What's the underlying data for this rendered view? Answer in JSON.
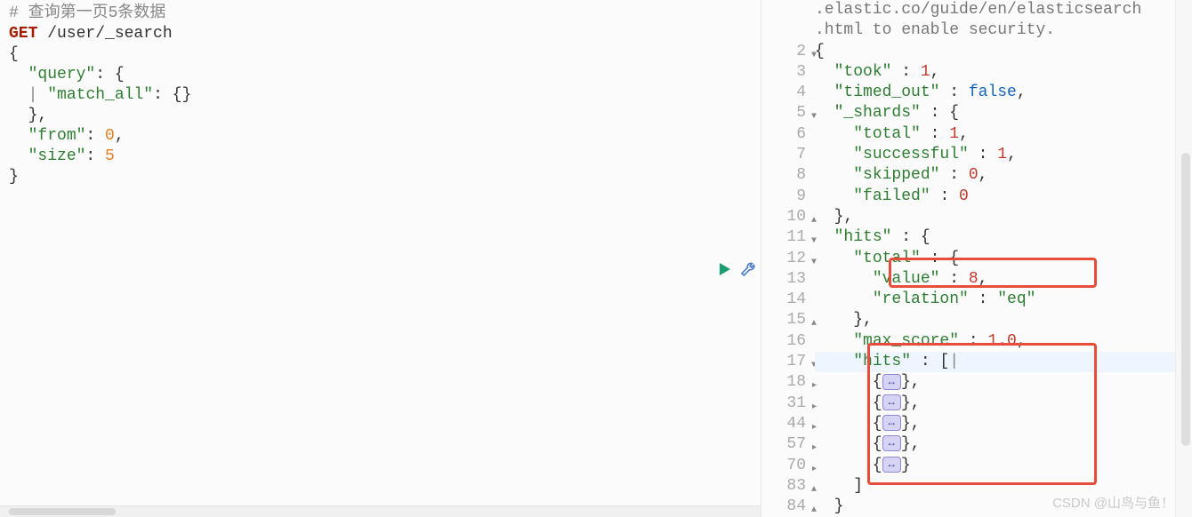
{
  "left": {
    "comment_prefix": "# ",
    "comment": "查询第一页5条数据",
    "method": "GET",
    "path": " /user/_search",
    "line3": "{",
    "query_key": "\"query\"",
    "match_all_key": "\"match_all\"",
    "line5_end": ": {}",
    "from_key": "\"from\"",
    "from_val": "0",
    "size_key": "\"size\"",
    "size_val": "5",
    "line9": "}"
  },
  "right_top": {
    "l1": ".elastic.co/guide/en/elasticsearch",
    "l2": ".html to enable security."
  },
  "lines": [
    {
      "n": "2",
      "fold": "▼",
      "c": "{"
    },
    {
      "n": "3",
      "fold": "",
      "c_key": "\"took\"",
      "c_after": " : ",
      "c_val": "1",
      "c_end": ","
    },
    {
      "n": "4",
      "fold": "",
      "c_key": "\"timed_out\"",
      "c_after": " : ",
      "c_bool": "false",
      "c_end": ","
    },
    {
      "n": "5",
      "fold": "▼",
      "c_key": "\"_shards\"",
      "c_after": " : {"
    },
    {
      "n": "6",
      "fold": "",
      "c_key": "\"total\"",
      "c_after": " : ",
      "c_val": "1",
      "c_end": ","
    },
    {
      "n": "7",
      "fold": "",
      "c_key": "\"successful\"",
      "c_after": " : ",
      "c_val": "1",
      "c_end": ","
    },
    {
      "n": "8",
      "fold": "",
      "c_key": "\"skipped\"",
      "c_after": " : ",
      "c_val": "0",
      "c_end": ","
    },
    {
      "n": "9",
      "fold": "",
      "c_key": "\"failed\"",
      "c_after": " : ",
      "c_val": "0"
    },
    {
      "n": "10",
      "fold": "▲",
      "c": "},",
      "ind": 1
    },
    {
      "n": "11",
      "fold": "▼",
      "c_key": "\"hits\"",
      "c_after": " : {"
    },
    {
      "n": "12",
      "fold": "▼",
      "c_key": "\"total\"",
      "c_after": " : {"
    },
    {
      "n": "13",
      "fold": "",
      "c_key": "\"value\"",
      "c_after": " : ",
      "c_val": "8",
      "c_end": ","
    },
    {
      "n": "14",
      "fold": "",
      "c_key": "\"relation\"",
      "c_after": " : ",
      "c_str": "\"eq\""
    },
    {
      "n": "15",
      "fold": "▲",
      "c": "},",
      "ind": 2
    },
    {
      "n": "16",
      "fold": "",
      "c_key": "\"max_score\"",
      "c_after": " : ",
      "c_val": "1.0",
      "c_end": ","
    },
    {
      "n": "17",
      "fold": "▼",
      "c_key": "\"hits\"",
      "c_after": " : [",
      "hl": true,
      "caret": "|"
    },
    {
      "n": "18",
      "fold": "▸",
      "badge": true,
      "bend": ","
    },
    {
      "n": "31",
      "fold": "▸",
      "badge": true,
      "bend": ","
    },
    {
      "n": "44",
      "fold": "▸",
      "badge": true,
      "bend": ","
    },
    {
      "n": "57",
      "fold": "▸",
      "badge": true,
      "bend": ","
    },
    {
      "n": "70",
      "fold": "▸",
      "badge": true,
      "bend": ""
    },
    {
      "n": "83",
      "fold": "▲",
      "c": "]",
      "ind": 2
    },
    {
      "n": "84",
      "fold": "▲",
      "c": "}",
      "ind": 1
    }
  ],
  "badge": "↔",
  "watermark": "CSDN @山鸟与鱼！"
}
